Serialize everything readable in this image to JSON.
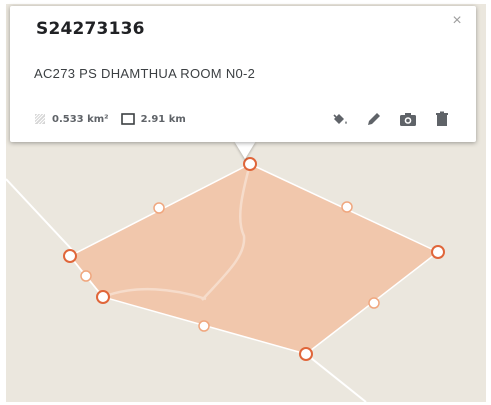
{
  "popup": {
    "title": "S24273136",
    "subtitle": "AC273 PS DHAMTHUA ROOM N0-2",
    "area": "0.533 km²",
    "perimeter": "2.91 km",
    "close_glyph": "×",
    "actions": [
      "paint-bucket-icon",
      "pencil-icon",
      "camera-icon",
      "trash-icon"
    ]
  },
  "colors": {
    "polygon_fill": "#f2c3a6",
    "polygon_stroke": "#ffffff",
    "vertex_stroke": "#e0663a",
    "map_background": "#ebe7de",
    "road": "#ffffff"
  }
}
